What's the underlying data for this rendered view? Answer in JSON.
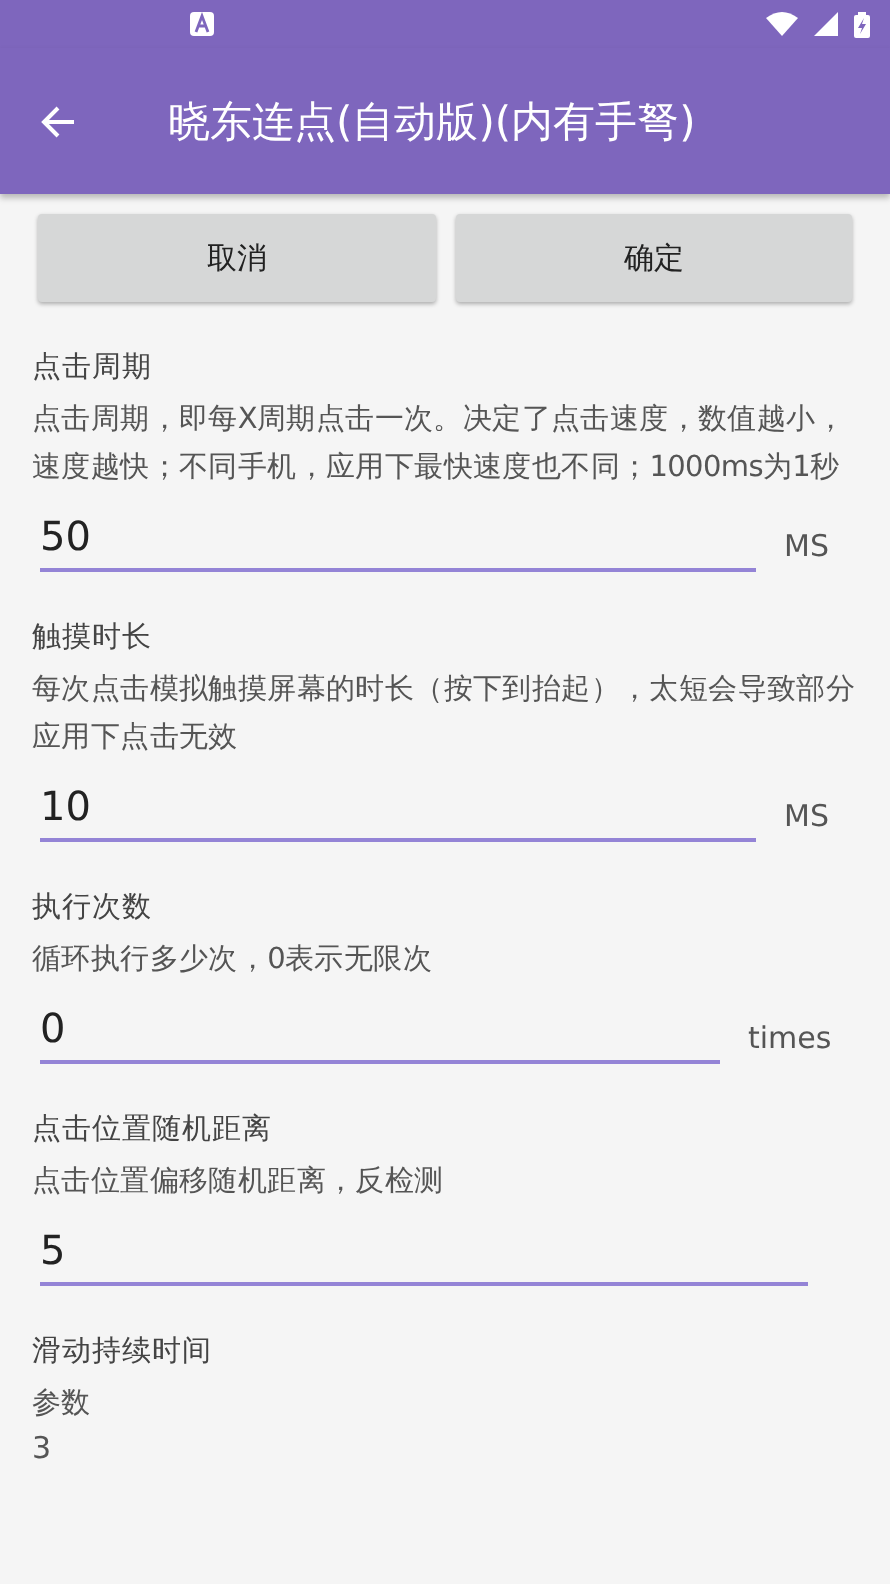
{
  "toolbar": {
    "title": "晓东连点(自动版)(内有手弩)"
  },
  "buttons": [
    "取消",
    "确定"
  ],
  "sections": [
    {
      "title": "点击周期",
      "description": "点击周期，即每X周期点击一次。决定了点击速度，数值越小，速度越快；不同手机，应用下最快速度也不同；1000ms为1秒",
      "kind": "field",
      "value": "50",
      "unit": "MS"
    },
    {
      "title": "触摸时长",
      "description": "每次点击模拟触摸屏幕的时长（按下到抬起），太短会导致部分应用下点击无效",
      "kind": "field",
      "value": "10",
      "unit": "MS"
    },
    {
      "title": "执行次数",
      "description": "循环执行多少次，0表示无限次",
      "kind": "field",
      "value": "0",
      "unit": "times"
    },
    {
      "title": "点击位置随机距离",
      "description": "点击位置偏移随机距离，反检测",
      "kind": "field",
      "value": "5"
    },
    {
      "title": "滑动持续时间",
      "description": "参数",
      "kind": "plain",
      "value": "3"
    }
  ]
}
